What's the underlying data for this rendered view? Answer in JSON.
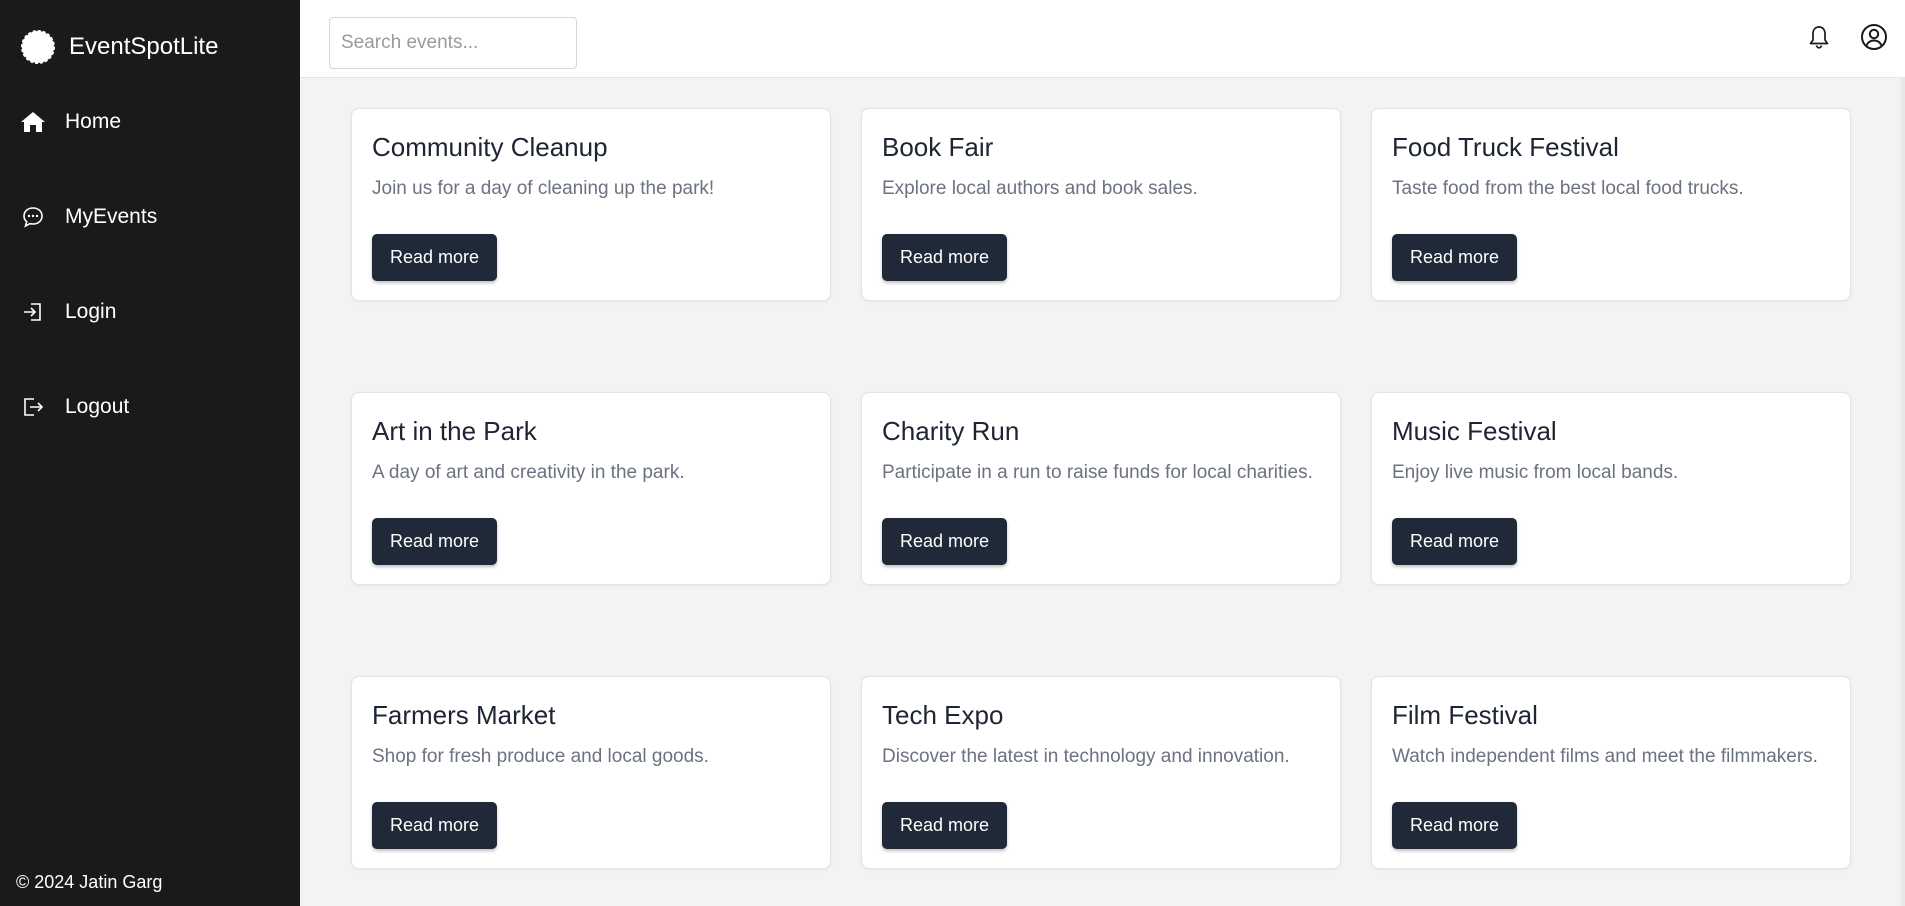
{
  "app": {
    "name": "EventSpotLite",
    "logo_icon": "chat-bubble-icon"
  },
  "sidebar": {
    "items": [
      {
        "label": "Home",
        "icon": "home-icon"
      },
      {
        "label": "MyEvents",
        "icon": "chat-icon"
      },
      {
        "label": "Login",
        "icon": "login-icon"
      },
      {
        "label": "Logout",
        "icon": "logout-icon"
      }
    ],
    "copyright": "© 2024 Jatin Garg"
  },
  "header": {
    "search_placeholder": "Search events...",
    "search_value": "",
    "notification_icon": "bell-icon",
    "profile_icon": "user-circle-icon"
  },
  "events": [
    {
      "title": "Community Cleanup",
      "description": "Join us for a day of cleaning up the park!",
      "button": "Read more"
    },
    {
      "title": "Book Fair",
      "description": "Explore local authors and book sales.",
      "button": "Read more"
    },
    {
      "title": "Food Truck Festival",
      "description": "Taste food from the best local food trucks.",
      "button": "Read more"
    },
    {
      "title": "Art in the Park",
      "description": "A day of art and creativity in the park.",
      "button": "Read more"
    },
    {
      "title": "Charity Run",
      "description": "Participate in a run to raise funds for local charities.",
      "button": "Read more"
    },
    {
      "title": "Music Festival",
      "description": "Enjoy live music from local bands.",
      "button": "Read more"
    },
    {
      "title": "Farmers Market",
      "description": "Shop for fresh produce and local goods.",
      "button": "Read more"
    },
    {
      "title": "Tech Expo",
      "description": "Discover the latest in technology and innovation.",
      "button": "Read more"
    },
    {
      "title": "Film Festival",
      "description": "Watch independent films and meet the filmmakers.",
      "button": "Read more"
    }
  ],
  "colors": {
    "sidebar_bg": "#1a1a1a",
    "button_bg": "#1f2937",
    "page_bg": "#f3f3f3"
  }
}
